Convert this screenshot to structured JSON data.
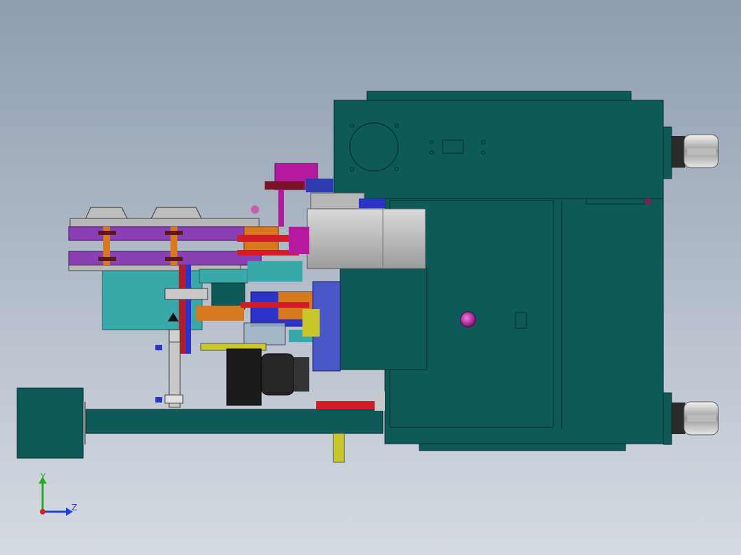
{
  "viewport": {
    "background_top": "#8e9db0",
    "background_bottom": "#d6dbe2"
  },
  "colors": {
    "cabinet": "#0d5a58",
    "cabinet_edge": "#062d2c",
    "purple_rail": "#8a3fb5",
    "teal_light": "#38a8a8",
    "magenta": "#b5199e",
    "orange": "#d7781f",
    "red": "#d11d2a",
    "yellow": "#c8c82a",
    "grey_block": "#b8b8b8",
    "blue": "#2b33c9",
    "motor_black": "#1b1b1b"
  },
  "triad": {
    "y_label": "Y",
    "z_label": "Z",
    "y_color": "#1fae1f",
    "z_color": "#1f3fe0",
    "x_color": "#d21f1f"
  },
  "parts": {
    "main_cabinet": "main-cabinet",
    "caster_wheel": "caster-wheel-icon",
    "geared_motor": "geared-motor",
    "feed_rails": "feed-rails",
    "cylinder": "pneumatic-cylinder"
  }
}
